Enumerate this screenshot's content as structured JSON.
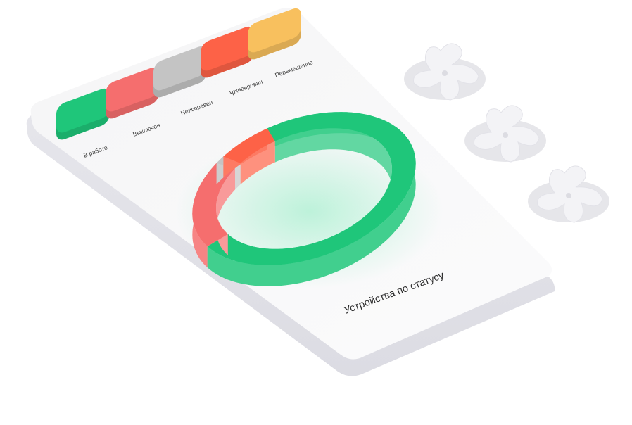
{
  "chart_data": {
    "type": "pie",
    "title": "Устройства по статусу",
    "categories": [
      "В работе",
      "Выключен",
      "Неисправен",
      "Архивирован",
      "Перемещение"
    ],
    "values": [
      72,
      19,
      1.5,
      7.5,
      0
    ],
    "colors": [
      "#1fc67a",
      "#f56e6e",
      "#c4c4c4",
      "#fd6247",
      "#f8c05e"
    ]
  }
}
